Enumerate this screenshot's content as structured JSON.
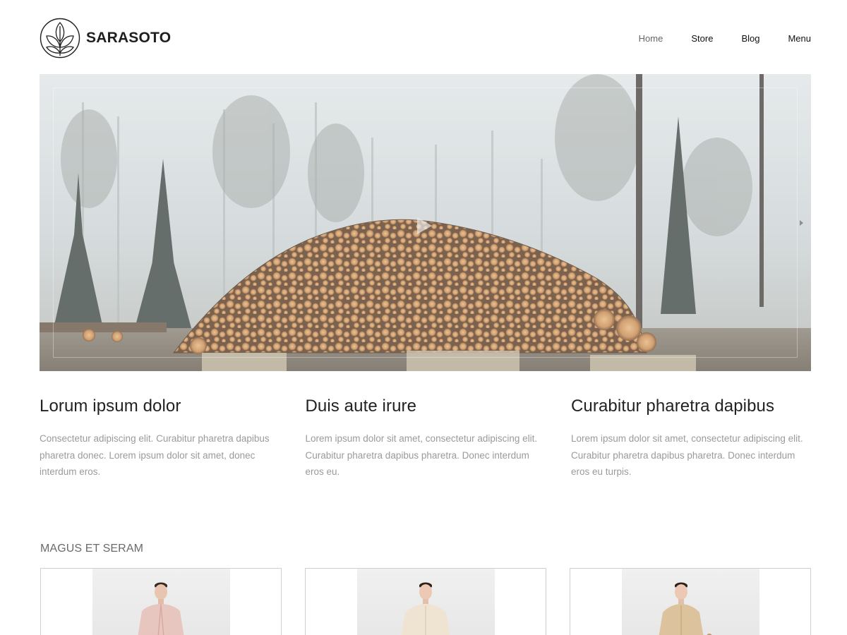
{
  "brand": {
    "name": "SARASOTO",
    "logo_icon": "leaf-logo-icon"
  },
  "nav": {
    "items": [
      {
        "label": "Home",
        "active": true
      },
      {
        "label": "Store",
        "active": false
      },
      {
        "label": "Blog",
        "active": false
      },
      {
        "label": "Menu",
        "active": false
      }
    ]
  },
  "hero": {
    "image": "foggy-forest-log-pile",
    "play_icon": "play-icon",
    "next_icon": "chevron-right-icon"
  },
  "features": [
    {
      "title": "Lorum ipsum dolor",
      "text": "Consectetur adipiscing elit. Curabitur pharetra dapibus pharetra donec. Lorem ipsum dolor sit amet, donec interdum eros."
    },
    {
      "title": "Duis aute irure",
      "text": "Lorem ipsum dolor sit amet, consectetur adipiscing elit. Curabitur pharetra dapibus pharetra. Donec interdum eros eu."
    },
    {
      "title": "Curabitur pharetra dapibus",
      "text": "Lorem ipsum dolor sit amet, consectetur adipiscing elit. Curabitur pharetra dapibus pharetra. Donec interdum eros eu turpis."
    }
  ],
  "section": {
    "title": "MAGUS ET SERAM"
  },
  "products": [
    {
      "image": "model-pink-jacket",
      "accent": "#e7c6c0"
    },
    {
      "image": "model-cream-blouse",
      "accent": "#efe4d2"
    },
    {
      "image": "model-beige-dress",
      "accent": "#dcc39e"
    }
  ],
  "colors": {
    "text": "#222222",
    "muted": "#9a9a9a",
    "nav_active": "#666666",
    "border": "#cfcfcf"
  }
}
